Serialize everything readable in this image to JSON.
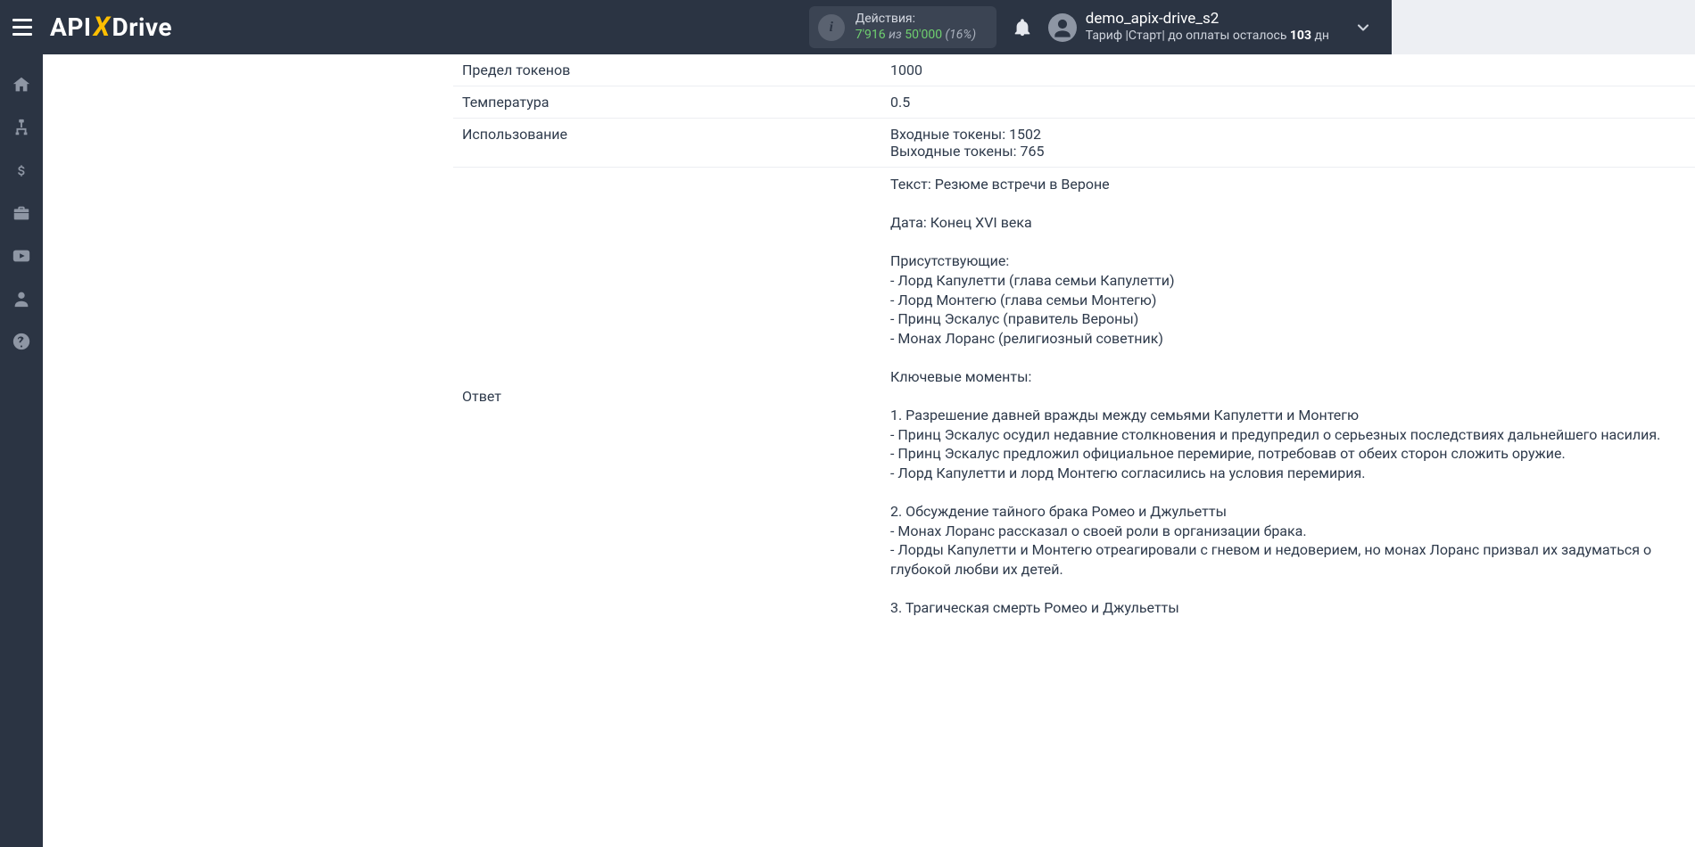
{
  "topbar": {
    "actions_label": "Действия:",
    "actions_used": "7'916",
    "actions_of": " из ",
    "actions_limit": "50'000",
    "actions_pct": " (16%)",
    "username": "demo_apix-drive_s2",
    "tariff_prefix": "Тариф |Старт|  до оплаты осталось ",
    "tariff_days": "103",
    "tariff_suffix": " дн"
  },
  "rows": {
    "token_limit_label": "Предел токенов",
    "token_limit_value": "1000",
    "temperature_label": "Температура",
    "temperature_value": "0.5",
    "usage_label": "Использование",
    "usage_value": "Входные токены: 1502\nВыходные токены: 765",
    "response_label": "Ответ",
    "response_value": "Текст: Резюме встречи в Вероне\n\nДата: Конец XVI века\n\nПрисутствующие:\n- Лорд Капулетти (глава семьи Капулетти)\n- Лорд Монтегю (глава семьи Монтегю)\n- Принц Эскалус (правитель Вероны)\n- Монах Лоранс (религиозный советник)\n\nКлючевые моменты:\n\n1. Разрешение давней вражды между семьями Капулетти и Монтегю\n- Принц Эскалус осудил недавние столкновения и предупредил о серьезных последствиях дальнейшего насилия.\n- Принц Эскалус предложил официальное перемирие, потребовав от обеих сторон сложить оружие.\n- Лорд Капулетти и лорд Монтегю согласились на условия перемирия.\n\n2. Обсуждение тайного брака Ромео и Джульетты\n- Монах Лоранс рассказал о своей роли в организации брака.\n- Лорды Капулетти и Монтегю отреагировали с гневом и недоверием, но монах Лоранс призвал их задуматься о глубокой любви их детей.\n\n3. Трагическая смерть Ромео и Джульетты"
  }
}
